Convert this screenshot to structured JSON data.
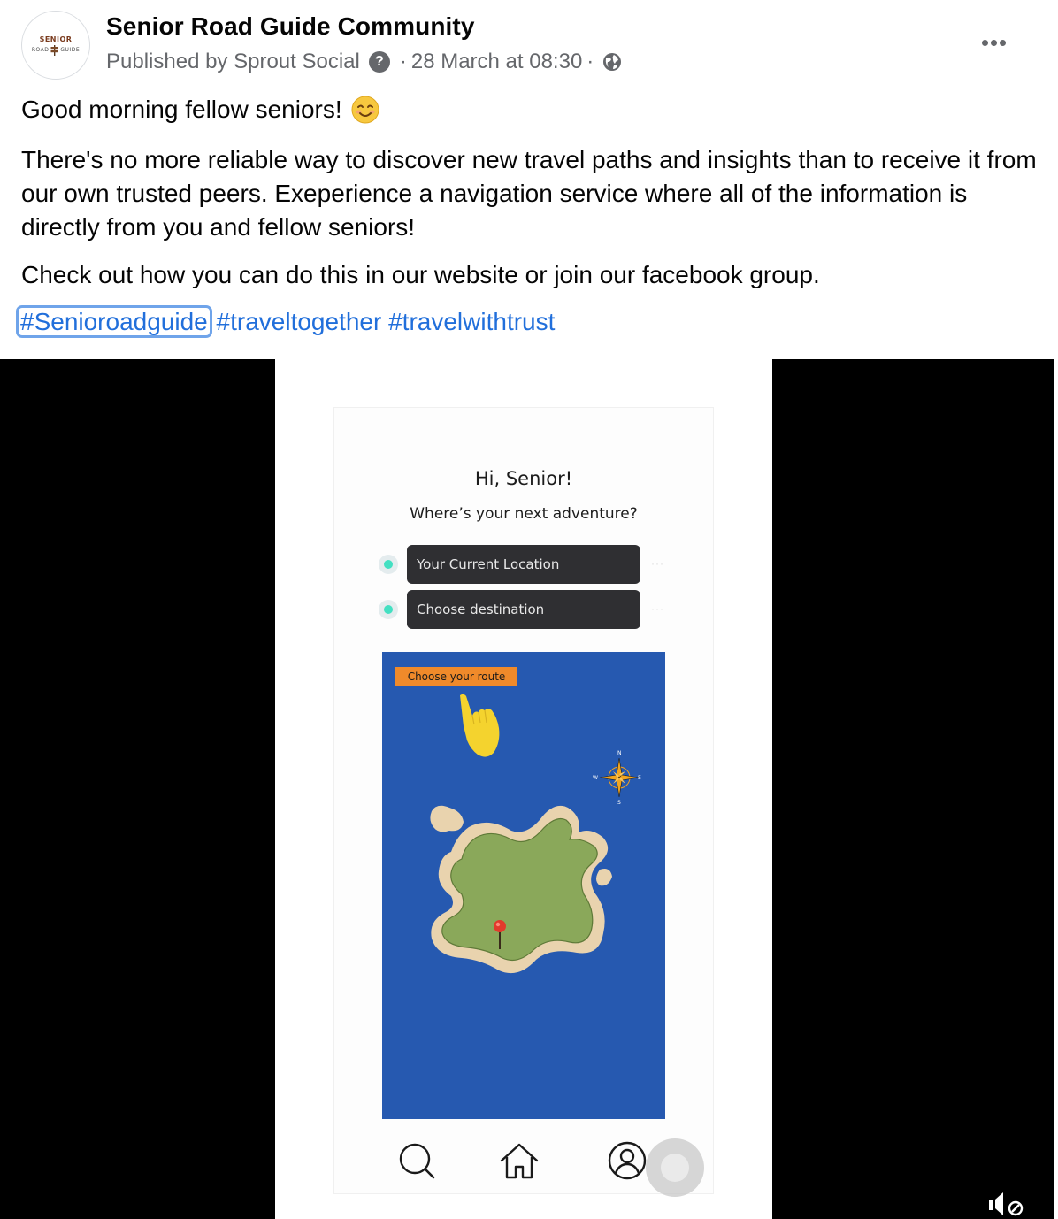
{
  "post": {
    "avatar": {
      "logo_top": "SENIOR",
      "logo_left": "ROAD",
      "logo_right": "GUIDE",
      "icon": "signpost-logo"
    },
    "page_name": "Senior Road Guide Community",
    "published_by": "Published by Sprout Social",
    "help_icon": "?",
    "separator": "·",
    "timestamp": "28 March at 08:30",
    "privacy_icon": "globe-icon",
    "more_icon": "more-horizontal-icon",
    "greeting": "Good morning fellow seniors!",
    "greeting_emoji": "smiling-face-emoji",
    "paragraph": "There's no more reliable way to discover new travel paths and insights than to receive it from our own trusted peers. Exeperience a navigation service where all of the information is directly from you and fellow seniors!",
    "call_to_action": "Check out how you can do this in our website or join our facebook group.",
    "hashtags": [
      "#Senioroadguide",
      "#traveltogether",
      "#travelwithtrust"
    ],
    "colors": {
      "link": "#216fdb",
      "secondary_text": "#65676b",
      "focus_ring": "#6fa4ea"
    }
  },
  "video": {
    "app_screen": {
      "title": "Hi, Senior!",
      "subtitle": "Where’s your next adventure?",
      "current_location_placeholder": "Your Current Location",
      "destination_placeholder": "Choose destination",
      "field_more": "···",
      "map": {
        "button_label": "Choose your route",
        "compass": {
          "n": "N",
          "e": "E",
          "s": "S",
          "w": "W"
        },
        "icons": [
          "pointing-hand-icon",
          "compass-icon",
          "island-icon",
          "map-pin-icon"
        ],
        "colors": {
          "sea": "#2659b0",
          "land": "#8aa85a",
          "sand": "#e9d3ae",
          "button": "#f08a2a"
        }
      },
      "tab_bar": [
        "search-icon",
        "home-icon",
        "profile-icon"
      ]
    },
    "controls": {
      "mute_icon": "muted-speaker-icon"
    }
  }
}
